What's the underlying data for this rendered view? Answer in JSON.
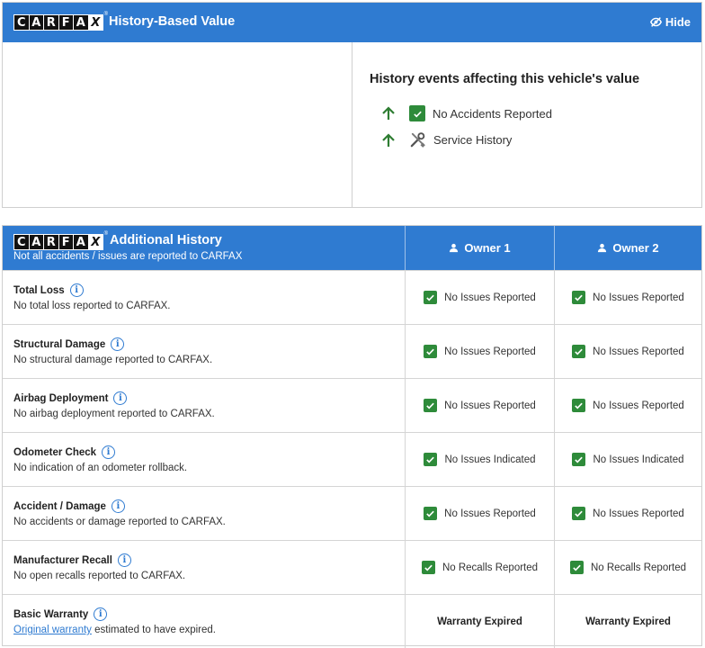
{
  "brand": {
    "logo_letters": [
      "C",
      "A",
      "R",
      "F",
      "A",
      "X"
    ]
  },
  "colors": {
    "accent": "#2f7bd1",
    "check": "#2e8b3a",
    "arrow_up": "#2e7d32"
  },
  "history_value": {
    "title": "History-Based Value",
    "hide_label": "Hide",
    "events_title": "History events affecting this vehicle's value",
    "events": [
      {
        "label": "No Accidents Reported",
        "icon": "green-check-icon",
        "trend": "up-arrow-icon"
      },
      {
        "label": "Service History",
        "icon": "wrench-screwdriver-icon",
        "trend": "up-arrow-icon"
      }
    ]
  },
  "additional_history": {
    "title": "Additional History",
    "subtitle": "Not all accidents / issues are reported to CARFAX",
    "owners": [
      "Owner 1",
      "Owner 2"
    ],
    "rows": [
      {
        "label": "Total Loss",
        "desc": "No total loss reported to CARFAX.",
        "values": [
          "No Issues Reported",
          "No Issues Reported"
        ]
      },
      {
        "label": "Structural Damage",
        "desc": "No structural damage reported to CARFAX.",
        "values": [
          "No Issues Reported",
          "No Issues Reported"
        ]
      },
      {
        "label": "Airbag Deployment",
        "desc": "No airbag deployment reported to CARFAX.",
        "values": [
          "No Issues Reported",
          "No Issues Reported"
        ]
      },
      {
        "label": "Odometer Check",
        "desc": "No indication of an odometer rollback.",
        "values": [
          "No Issues Indicated",
          "No Issues Indicated"
        ]
      },
      {
        "label": "Accident / Damage",
        "desc": "No accidents or damage reported to CARFAX.",
        "values": [
          "No Issues Reported",
          "No Issues Reported"
        ]
      },
      {
        "label": "Manufacturer Recall",
        "desc": "No open recalls reported to CARFAX.",
        "values": [
          "No Recalls Reported",
          "No Recalls Reported"
        ]
      },
      {
        "label": "Basic Warranty",
        "desc_link": "Original warranty",
        "desc_rest": " estimated to have expired.",
        "values": [
          "Warranty Expired",
          "Warranty Expired"
        ]
      }
    ]
  }
}
